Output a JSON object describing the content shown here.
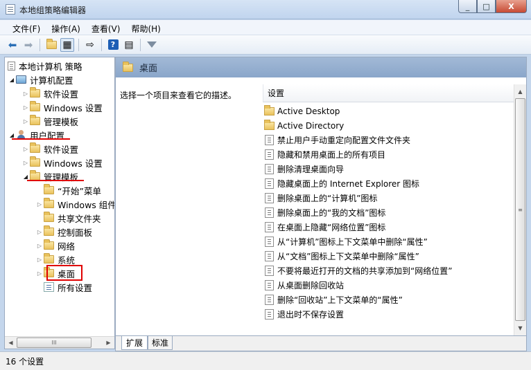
{
  "window": {
    "title": "本地组策略编辑器",
    "min": "_",
    "max": "□",
    "close": "X"
  },
  "menu": [
    "文件(F)",
    "操作(A)",
    "查看(V)",
    "帮助(H)"
  ],
  "toolbar": {
    "help": "?"
  },
  "tree": {
    "root": "本地计算机 策略",
    "computer_config": "计算机配置",
    "computer_items": [
      "软件设置",
      "Windows 设置",
      "管理模板"
    ],
    "user_config": "用户配置",
    "user_items": [
      "软件设置",
      "Windows 设置"
    ],
    "admin_templates": "管理模板",
    "admin_children": [
      "“开始”菜单",
      "Windows 组件",
      "共享文件夹",
      "控制面板",
      "网络",
      "系统",
      "桌面",
      "所有设置"
    ]
  },
  "header": {
    "folder_title": "桌面"
  },
  "description": "选择一个项目来查看它的描述。",
  "list": {
    "column": "设置",
    "items": [
      {
        "label": "Active Desktop",
        "type": "folder"
      },
      {
        "label": "Active Directory",
        "type": "folder"
      },
      {
        "label": "禁止用户手动重定向配置文件文件夹",
        "type": "setting"
      },
      {
        "label": "隐藏和禁用桌面上的所有项目",
        "type": "setting"
      },
      {
        "label": "删除清理桌面向导",
        "type": "setting"
      },
      {
        "label": "隐藏桌面上的 Internet Explorer 图标",
        "type": "setting"
      },
      {
        "label": "删除桌面上的“计算机”图标",
        "type": "setting"
      },
      {
        "label": "删除桌面上的“我的文档”图标",
        "type": "setting"
      },
      {
        "label": "在桌面上隐藏“网络位置”图标",
        "type": "setting"
      },
      {
        "label": "从“计算机”图标上下文菜单中删除“属性”",
        "type": "setting"
      },
      {
        "label": "从“文档”图标上下文菜单中删除“属性”",
        "type": "setting"
      },
      {
        "label": "不要将最近打开的文档的共享添加到“网络位置”",
        "type": "setting"
      },
      {
        "label": "从桌面删除回收站",
        "type": "setting"
      },
      {
        "label": "删除“回收站”上下文菜单的“属性”",
        "type": "setting"
      },
      {
        "label": "退出时不保存设置",
        "type": "setting"
      }
    ]
  },
  "tabs": [
    "扩展",
    "标准"
  ],
  "scroll": {
    "grip": "III"
  },
  "status": "16 个设置",
  "colors": {
    "annotation": "#e00000",
    "header": "#97b0d0"
  }
}
